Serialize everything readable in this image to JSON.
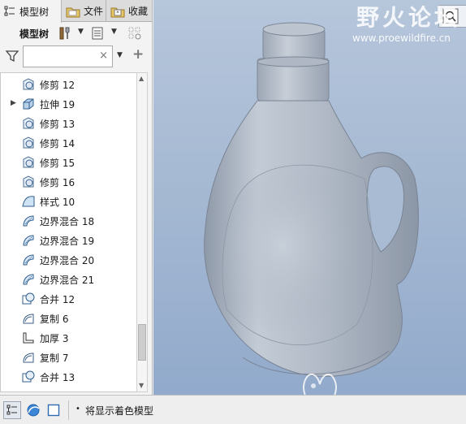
{
  "tabs": [
    {
      "label": "模型树",
      "icon": "model-tree-icon"
    },
    {
      "label": "文件",
      "icon": "folder-icon"
    },
    {
      "label": "收藏",
      "icon": "favorites-icon"
    }
  ],
  "toolbar": {
    "label": "模型树"
  },
  "filter": {
    "placeholder": "",
    "clear": "×",
    "add": "+"
  },
  "tree_items": [
    {
      "label": "修剪 12",
      "icon": "trim-icon",
      "expandable": false
    },
    {
      "label": "拉伸 19",
      "icon": "extrude-icon",
      "expandable": true
    },
    {
      "label": "修剪 13",
      "icon": "trim-icon",
      "expandable": false
    },
    {
      "label": "修剪 14",
      "icon": "trim-icon",
      "expandable": false
    },
    {
      "label": "修剪 15",
      "icon": "trim-icon",
      "expandable": false
    },
    {
      "label": "修剪 16",
      "icon": "trim-icon",
      "expandable": false
    },
    {
      "label": "样式 10",
      "icon": "style-icon",
      "expandable": false
    },
    {
      "label": "边界混合 18",
      "icon": "boundary-blend-icon",
      "expandable": false
    },
    {
      "label": "边界混合 19",
      "icon": "boundary-blend-icon",
      "expandable": false
    },
    {
      "label": "边界混合 20",
      "icon": "boundary-blend-icon",
      "expandable": false
    },
    {
      "label": "边界混合 21",
      "icon": "boundary-blend-icon",
      "expandable": false
    },
    {
      "label": "合并 12",
      "icon": "merge-icon",
      "expandable": false
    },
    {
      "label": "复制 6",
      "icon": "copy-icon",
      "expandable": false
    },
    {
      "label": "加厚 3",
      "icon": "thicken-icon",
      "expandable": false
    },
    {
      "label": "复制 7",
      "icon": "copy-icon",
      "expandable": false
    },
    {
      "label": "合并 13",
      "icon": "merge-icon",
      "expandable": false
    }
  ],
  "status": {
    "bullet": "•",
    "message": "将显示着色模型"
  },
  "watermark": {
    "title": "野火论坛",
    "url": "www.proewildfire.cn"
  },
  "colors": {
    "viewport_top": "#b6c6db",
    "viewport_bottom": "#92aacb",
    "bottle": "#a4afbd"
  }
}
